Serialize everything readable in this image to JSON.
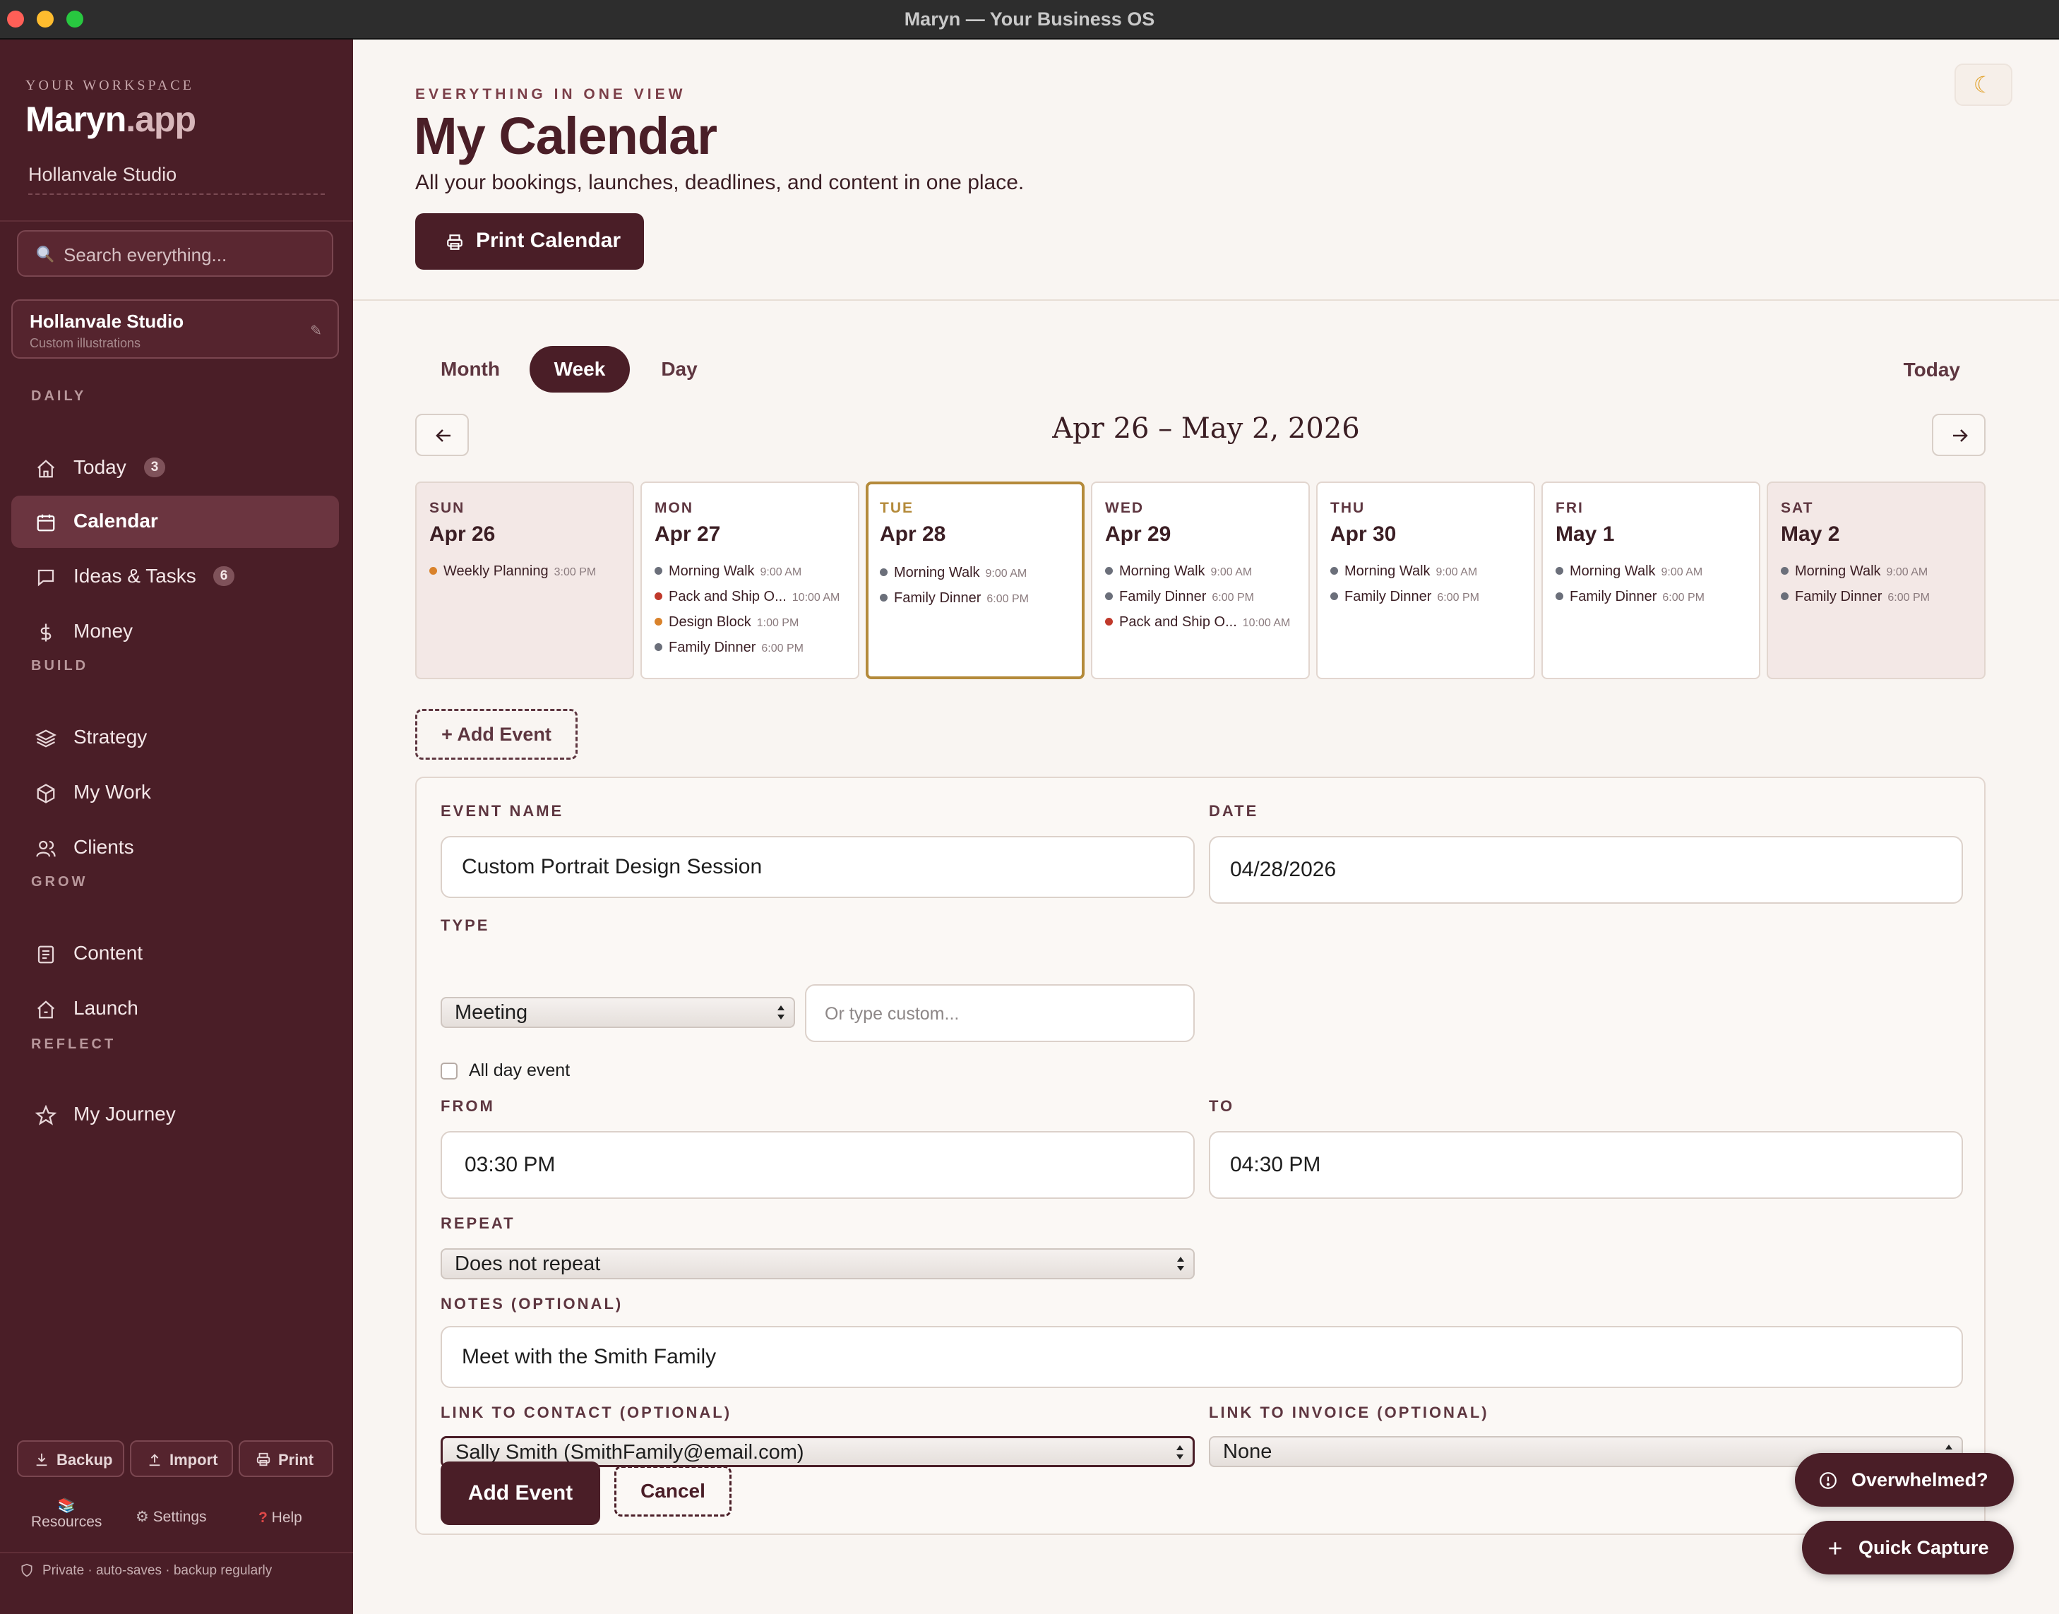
{
  "window": {
    "title": "Maryn — Your Business OS"
  },
  "sidebar": {
    "workspace_label": "YOUR WORKSPACE",
    "brand_main": "Maryn",
    "brand_suffix": ".app",
    "studio_name": "Hollanvale Studio",
    "search_placeholder": "Search everything...",
    "studio_card": {
      "name": "Hollanvale Studio",
      "subtitle": "Custom illustrations",
      "edit_icon": "pencil-icon"
    },
    "sections": {
      "daily": "DAILY",
      "build": "BUILD",
      "grow": "GROW",
      "reflect": "REFLECT"
    },
    "items": [
      {
        "label": "Today",
        "icon": "home-icon",
        "badge": "3"
      },
      {
        "label": "Calendar",
        "icon": "calendar-icon",
        "active": true
      },
      {
        "label": "Ideas & Tasks",
        "icon": "chat-icon",
        "badge": "6"
      },
      {
        "label": "Money",
        "icon": "dollar-icon"
      },
      {
        "label": "Strategy",
        "icon": "layers-icon"
      },
      {
        "label": "My Work",
        "icon": "box-icon"
      },
      {
        "label": "Clients",
        "icon": "users-icon"
      },
      {
        "label": "Content",
        "icon": "document-icon"
      },
      {
        "label": "Launch",
        "icon": "rocket-home-icon"
      },
      {
        "label": "My Journey",
        "icon": "star-icon"
      }
    ],
    "buttons": {
      "backup": "Backup",
      "import": "Import",
      "print": "Print"
    },
    "footer_links": {
      "resources": "Resources",
      "settings": "Settings",
      "help": "Help"
    },
    "privacy": "Private · auto-saves · backup regularly"
  },
  "header": {
    "eyebrow": "EVERYTHING IN ONE VIEW",
    "title": "My Calendar",
    "subtitle": "All your bookings, launches, deadlines, and content in one place.",
    "print_button": "Print Calendar",
    "theme_icon": "moon-icon"
  },
  "calendar": {
    "views": [
      "Month",
      "Week",
      "Day"
    ],
    "active_view": "Week",
    "today_link": "Today",
    "range_title": "Apr 26 – May 2, 2026",
    "days": [
      {
        "dow": "SUN",
        "date": "Apr 26",
        "events": [
          {
            "name": "Weekly Planning",
            "time": "3:00 PM",
            "color": "#d9822b"
          }
        ]
      },
      {
        "dow": "MON",
        "date": "Apr 27",
        "events": [
          {
            "name": "Morning Walk",
            "time": "9:00 AM",
            "color": "#6b6f7a"
          },
          {
            "name": "Pack and Ship O...",
            "time": "10:00 AM",
            "color": "#c0392b"
          },
          {
            "name": "Design Block",
            "time": "1:00 PM",
            "color": "#d9822b"
          },
          {
            "name": "Family Dinner",
            "time": "6:00 PM",
            "color": "#6b6f7a"
          }
        ]
      },
      {
        "dow": "TUE",
        "date": "Apr 28",
        "events": [
          {
            "name": "Morning Walk",
            "time": "9:00 AM",
            "color": "#6b6f7a"
          },
          {
            "name": "Family Dinner",
            "time": "6:00 PM",
            "color": "#6b6f7a"
          }
        ]
      },
      {
        "dow": "WED",
        "date": "Apr 29",
        "events": [
          {
            "name": "Morning Walk",
            "time": "9:00 AM",
            "color": "#6b6f7a"
          },
          {
            "name": "Family Dinner",
            "time": "6:00 PM",
            "color": "#6b6f7a"
          },
          {
            "name": "Pack and Ship O...",
            "time": "10:00 AM",
            "color": "#c0392b"
          }
        ]
      },
      {
        "dow": "THU",
        "date": "Apr 30",
        "events": [
          {
            "name": "Morning Walk",
            "time": "9:00 AM",
            "color": "#6b6f7a"
          },
          {
            "name": "Family Dinner",
            "time": "6:00 PM",
            "color": "#6b6f7a"
          }
        ]
      },
      {
        "dow": "FRI",
        "date": "May 1",
        "events": [
          {
            "name": "Morning Walk",
            "time": "9:00 AM",
            "color": "#6b6f7a"
          },
          {
            "name": "Family Dinner",
            "time": "6:00 PM",
            "color": "#6b6f7a"
          }
        ]
      },
      {
        "dow": "SAT",
        "date": "May 2",
        "events": [
          {
            "name": "Morning Walk",
            "time": "9:00 AM",
            "color": "#6b6f7a"
          },
          {
            "name": "Family Dinner",
            "time": "6:00 PM",
            "color": "#6b6f7a"
          }
        ]
      }
    ],
    "add_event_link": "+ Add Event"
  },
  "form": {
    "event_name_label": "EVENT NAME",
    "event_name_value": "Custom Portrait Design Session",
    "date_label": "DATE",
    "date_value": "04/28/2026",
    "type_label": "TYPE",
    "type_value": "Meeting",
    "type_custom_placeholder": "Or type custom...",
    "all_day_label": "All day event",
    "from_label": "FROM",
    "from_value": "03:30 PM",
    "to_label": "TO",
    "to_value": "04:30 PM",
    "repeat_label": "REPEAT",
    "repeat_value": "Does not repeat",
    "notes_label": "NOTES (OPTIONAL)",
    "notes_value": "Meet with the Smith Family",
    "contact_label": "LINK TO CONTACT (OPTIONAL)",
    "contact_value": "Sally Smith (SmithFamily@email.com)",
    "invoice_label": "LINK TO INVOICE (OPTIONAL)",
    "invoice_value": "None",
    "submit_label": "Add Event",
    "cancel_label": "Cancel"
  },
  "floating": {
    "overwhelmed": "Overwhelmed?",
    "quick_capture": "Quick Capture"
  },
  "colors": {
    "accent": "#4a1e27",
    "today_border": "#b48a3a",
    "background": "#f9f5f2"
  }
}
